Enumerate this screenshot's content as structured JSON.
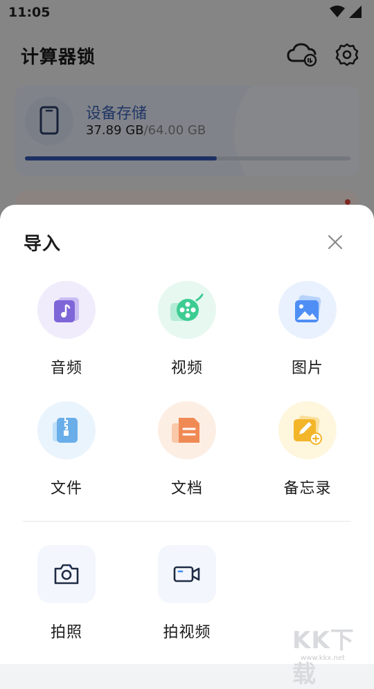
{
  "status_bar": {
    "time": "11:05",
    "icons": [
      "wifi-icon",
      "signal-icon"
    ]
  },
  "app_bar": {
    "title": "计算器锁",
    "icons": [
      "cloud-sync-icon",
      "gear-icon"
    ]
  },
  "storage": {
    "label": "设备存储",
    "used": "37.89 GB",
    "total": "/64.00 GB",
    "progress_fraction": 0.59,
    "accent": "#3458b5"
  },
  "import_sheet": {
    "title": "导入",
    "items": [
      {
        "label": "音频",
        "icon": "music-note-icon",
        "color": "#7e66d8"
      },
      {
        "label": "视频",
        "icon": "film-reel-icon",
        "color": "#3ccc92"
      },
      {
        "label": "图片",
        "icon": "picture-icon",
        "color": "#4f8ff5"
      },
      {
        "label": "文件",
        "icon": "zip-file-icon",
        "color": "#6aaee9"
      },
      {
        "label": "文档",
        "icon": "document-icon",
        "color": "#f08a55"
      },
      {
        "label": "备忘录",
        "icon": "memo-pencil-icon",
        "color": "#f3b52a"
      }
    ],
    "capture": [
      {
        "label": "拍照",
        "icon": "camera-icon"
      },
      {
        "label": "拍视频",
        "icon": "video-camera-icon"
      }
    ]
  },
  "watermark": {
    "text": "KK下载",
    "url": "www.kkx.net"
  }
}
